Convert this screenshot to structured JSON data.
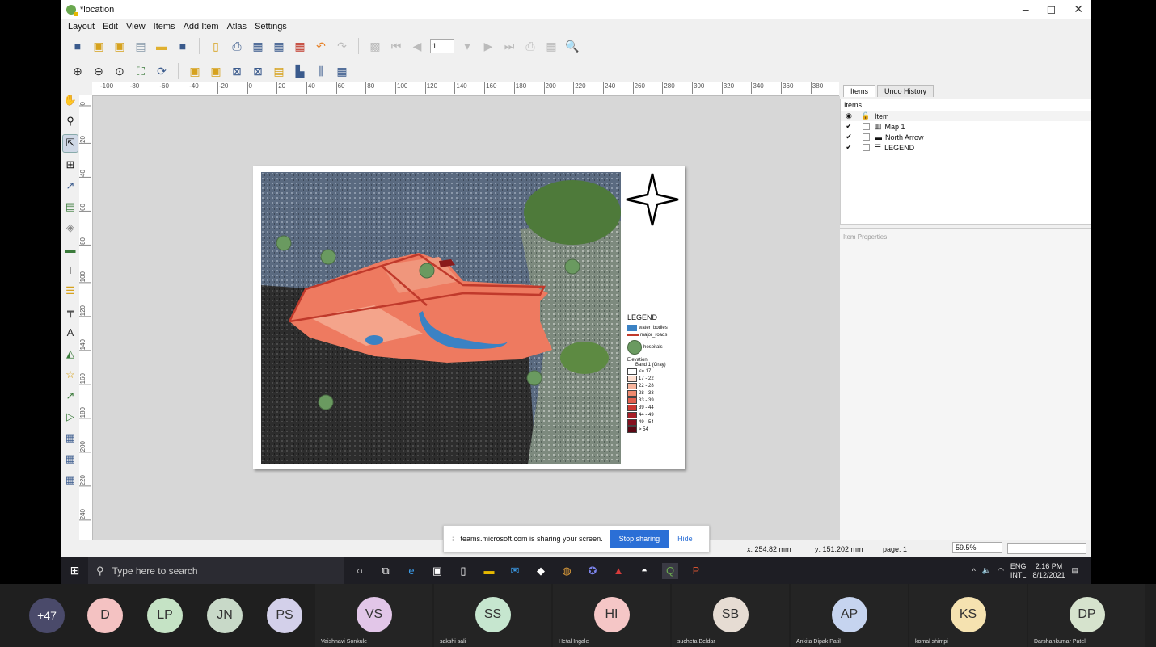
{
  "window": {
    "title": "*location",
    "minimize": "–",
    "maximize": "◻",
    "close": "✕"
  },
  "menu": [
    "Layout",
    "Edit",
    "View",
    "Items",
    "Add Item",
    "Atlas",
    "Settings"
  ],
  "toolbar": {
    "page_value": "1"
  },
  "ruler_h": [
    "-100",
    "-80",
    "-60",
    "-40",
    "-20",
    "0",
    "20",
    "40",
    "60",
    "80",
    "100",
    "120",
    "140",
    "160",
    "180",
    "200",
    "220",
    "240",
    "260",
    "280",
    "300",
    "320",
    "340",
    "360",
    "380"
  ],
  "ruler_v": [
    "0",
    "20",
    "40",
    "60",
    "80",
    "100",
    "120",
    "140",
    "160",
    "180",
    "200",
    "220",
    "240"
  ],
  "map": {
    "north_arrow": "N",
    "legend": {
      "title": "LEGEND",
      "water": "water_bodies",
      "roads": "major_roads",
      "hospitals": "hospitals",
      "elevation": "Elevation",
      "band": "Band 1 (Gray)",
      "classes": [
        {
          "label": "<= 17",
          "color": "#ffffff"
        },
        {
          "label": "17 - 22",
          "color": "#fde0d2"
        },
        {
          "label": "22 - 28",
          "color": "#f7b49c"
        },
        {
          "label": "28 - 33",
          "color": "#ef8a6f"
        },
        {
          "label": "33 - 39",
          "color": "#e2604e"
        },
        {
          "label": "39 - 44",
          "color": "#cc3a33"
        },
        {
          "label": "44 - 49",
          "color": "#a81f27"
        },
        {
          "label": "49 - 54",
          "color": "#86101f"
        },
        {
          "label": "> 54",
          "color": "#5c0714"
        }
      ]
    }
  },
  "panel": {
    "tabs": [
      "Items",
      "Undo History"
    ],
    "items_header": "Items",
    "column_item": "Item",
    "items": [
      "Map 1",
      "North Arrow",
      "LEGEND"
    ],
    "properties_title": "Item Properties"
  },
  "status": {
    "x": "x: 254.82 mm",
    "y": "y: 151.202 mm",
    "page": "page: 1",
    "zoom": "59.5%"
  },
  "share": {
    "message": "teams.microsoft.com is sharing your screen.",
    "stop": "Stop sharing",
    "hide": "Hide"
  },
  "taskbar": {
    "search_placeholder": "Type here to search",
    "lang1": "ENG",
    "lang2": "INTL",
    "time": "2:16 PM",
    "date": "8/12/2021"
  },
  "meeting": {
    "overflow": "+47",
    "small": [
      {
        "initials": "D",
        "color": "#f4c2c2"
      },
      {
        "initials": "LP",
        "color": "#c5e3c5"
      },
      {
        "initials": "JN",
        "color": "#c8d9c8"
      },
      {
        "initials": "PS",
        "color": "#d3d0ea"
      }
    ],
    "tiles": [
      {
        "initials": "VS",
        "name": "Vaishnavi Sonkule",
        "color": "#e2c6e8"
      },
      {
        "initials": "SS",
        "name": "sakshi sali",
        "color": "#c6e6cf"
      },
      {
        "initials": "HI",
        "name": "Hetal Ingale",
        "color": "#f5c6c6"
      },
      {
        "initials": "SB",
        "name": "sucheta Beldar",
        "color": "#e6dcd3"
      },
      {
        "initials": "AP",
        "name": "Ankita Dipak Patil",
        "color": "#c6d4ef"
      },
      {
        "initials": "KS",
        "name": "komal shimpi",
        "color": "#f5e2b0"
      },
      {
        "initials": "DP",
        "name": "Darshankumar Patel",
        "color": "#d6e3cd"
      }
    ]
  }
}
